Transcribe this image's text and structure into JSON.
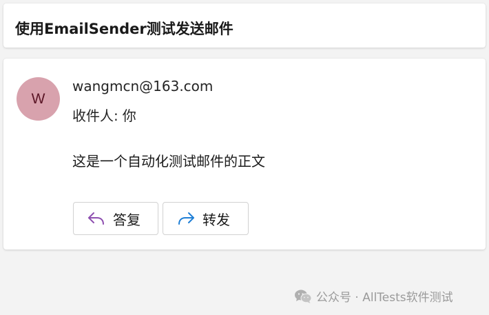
{
  "email": {
    "subject": "使用EmailSender测试发送邮件",
    "avatar_letter": "W",
    "sender": "wangmcn@163.com",
    "recipient_label": "收件人:",
    "recipient_value": "你",
    "body": "这是一个自动化测试邮件的正文"
  },
  "actions": {
    "reply_label": "答复",
    "reply_icon": "reply-arrow-icon",
    "forward_label": "转发",
    "forward_icon": "forward-arrow-icon"
  },
  "watermark": {
    "text": "公众号 · AllTests软件测试",
    "icon": "wechat-icon"
  },
  "colors": {
    "avatar_bg": "#d8a2ad",
    "avatar_text": "#5b1626",
    "reply_icon": "#8e4fb0",
    "forward_icon": "#1f7fd6",
    "background": "#f3f3f3"
  }
}
